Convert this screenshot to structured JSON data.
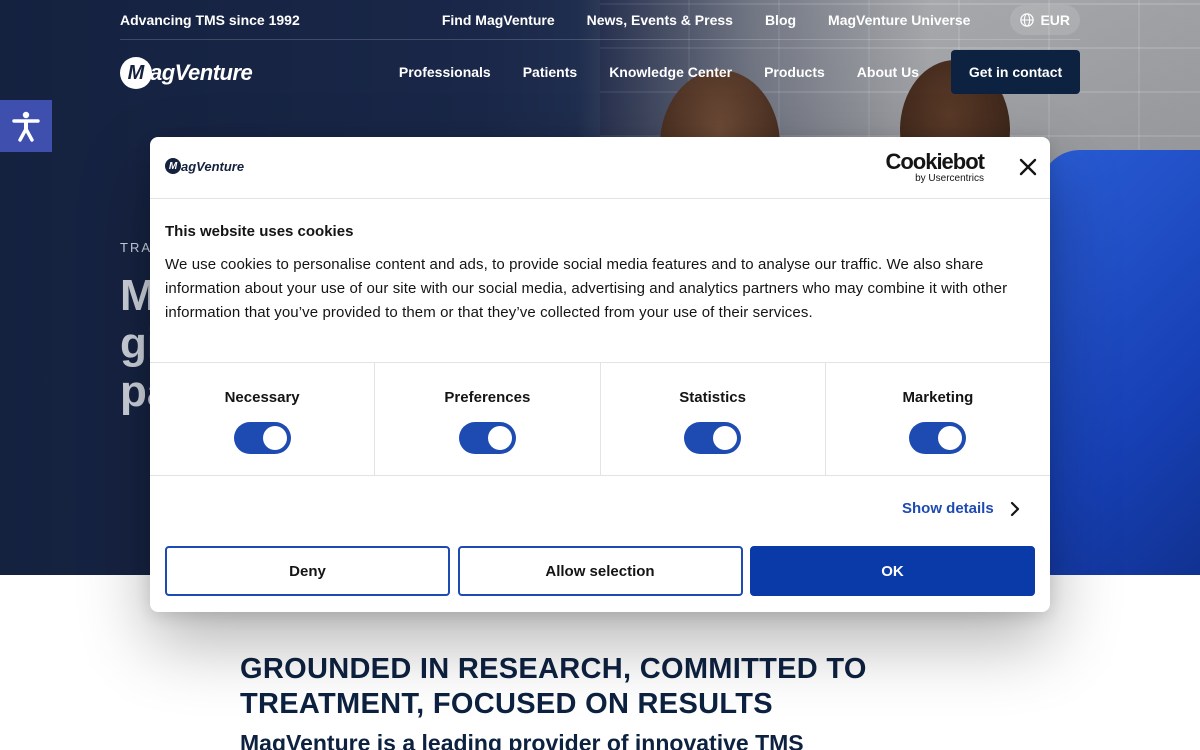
{
  "topbar": {
    "tagline": "Advancing TMS since 1992",
    "links": [
      "Find MagVenture",
      "News, Events & Press",
      "Blog",
      "MagVenture Universe"
    ],
    "currency": "EUR",
    "currency_icon": "globe-icon"
  },
  "nav": {
    "logo_mark": "M",
    "logo_text": "agVenture",
    "items": [
      "Professionals",
      "Patients",
      "Knowledge Center",
      "Products",
      "About Us"
    ],
    "cta": "Get in contact"
  },
  "hero": {
    "eyebrow": "TRA",
    "title_lines": [
      "M",
      "gi",
      "pa"
    ]
  },
  "accessibility": {
    "icon": "accessibility-icon"
  },
  "section": {
    "title": "GROUNDED IN RESEARCH, COMMITTED TO TREATMENT, FOCUSED ON RESULTS",
    "lead": "MagVenture is a leading provider of innovative TMS"
  },
  "cookie_dialog": {
    "brand_mark": "M",
    "brand_text": "agVenture",
    "provider": "Cookiebot",
    "provider_sub": "by Usercentrics",
    "title": "This website uses cookies",
    "text": "We use cookies to personalise content and ads, to provide social media features and to analyse our traffic. We also share information about your use of our site with our social media, advertising and analytics partners who may combine it with other information that you’ve provided to them or that they’ve collected from your use of their services.",
    "categories": [
      {
        "label": "Necessary",
        "checked": true
      },
      {
        "label": "Preferences",
        "checked": true
      },
      {
        "label": "Statistics",
        "checked": true
      },
      {
        "label": "Marketing",
        "checked": true
      }
    ],
    "show_details": "Show details",
    "buttons": {
      "deny": "Deny",
      "allow_selection": "Allow selection",
      "ok": "OK"
    }
  },
  "colors": {
    "navy": "#14213f",
    "accent_blue": "#1d4bb2",
    "ok_blue": "#0a3aa8",
    "a11y_blue": "#3e4fad"
  }
}
